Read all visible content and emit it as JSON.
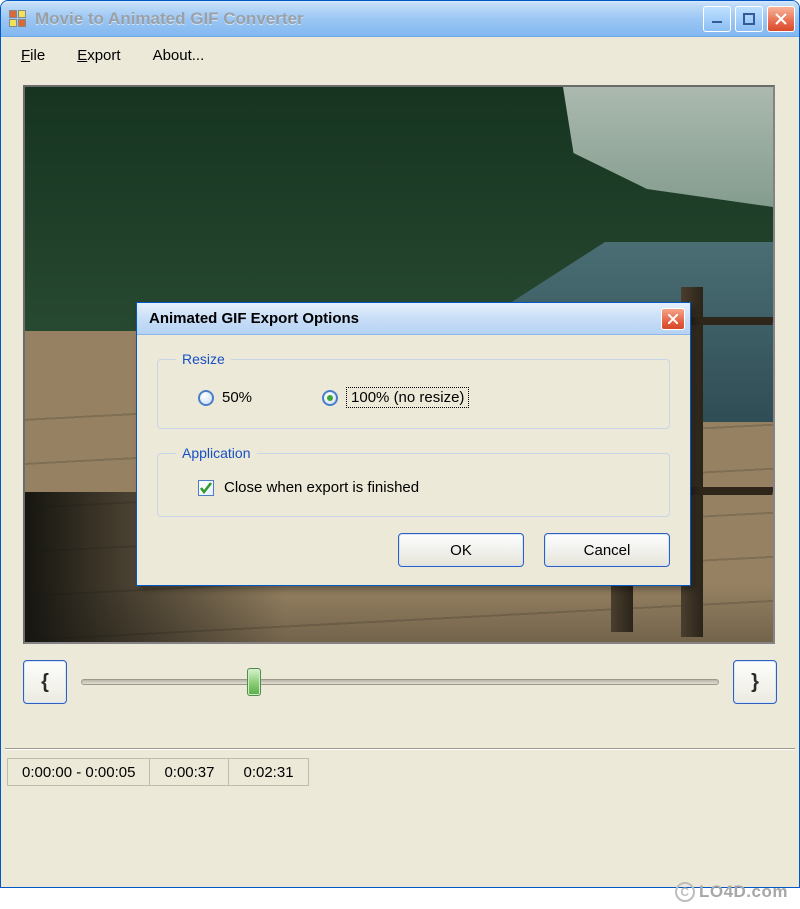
{
  "window": {
    "title": "Movie to Animated GIF Converter",
    "controls": {
      "minimize": "–",
      "maximize": "□",
      "close": "X"
    }
  },
  "menubar": {
    "file": {
      "label": "File",
      "underline": "F"
    },
    "export": {
      "label": "Export",
      "underline": "E"
    },
    "about": {
      "label": "About..."
    }
  },
  "dialog": {
    "title": "Animated GIF Export Options",
    "close": "X",
    "resize": {
      "legend": "Resize",
      "opt50": "50%",
      "opt100": "100% (no resize)",
      "selected": "100"
    },
    "application": {
      "legend": "Application",
      "close_when_finished_label": "Close when export is finished",
      "close_when_finished_checked": true
    },
    "ok": "OK",
    "cancel": "Cancel"
  },
  "seek": {
    "mark_in": "{",
    "mark_out": "}",
    "position_percent": 27
  },
  "status": {
    "range": "0:00:00 - 0:00:05",
    "current": "0:00:37",
    "total": "0:02:31"
  },
  "watermark": "LO4D.com"
}
